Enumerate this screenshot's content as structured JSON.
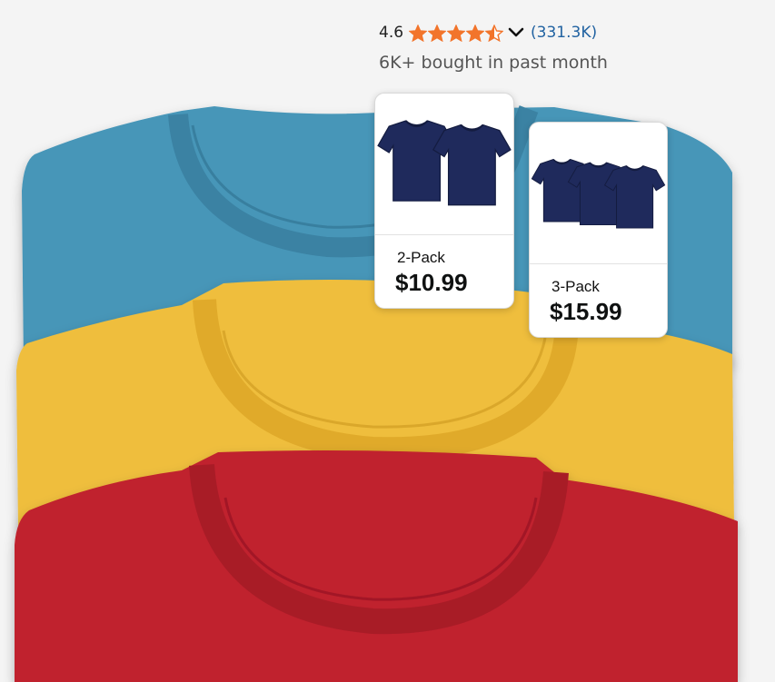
{
  "rating": {
    "value": "4.6",
    "stars_filled": 4.5,
    "stars_max": 5,
    "count": "(331.3K)",
    "star_color": "#f2742b",
    "link_color": "#2162a1",
    "star_icon": "star-icon",
    "chevron_icon": "chevron-down-icon"
  },
  "bought_text": "6K+ bought in past month",
  "packs": [
    {
      "label": "2-Pack",
      "price": "$10.99",
      "shirts": 2,
      "shirt_color": "#1f2a5c"
    },
    {
      "label": "3-Pack",
      "price": "$15.99",
      "shirts": 3,
      "shirt_color": "#1f2a5c"
    }
  ],
  "product_colors": [
    "#4796b8",
    "#efbe3c",
    "#c0212f"
  ]
}
